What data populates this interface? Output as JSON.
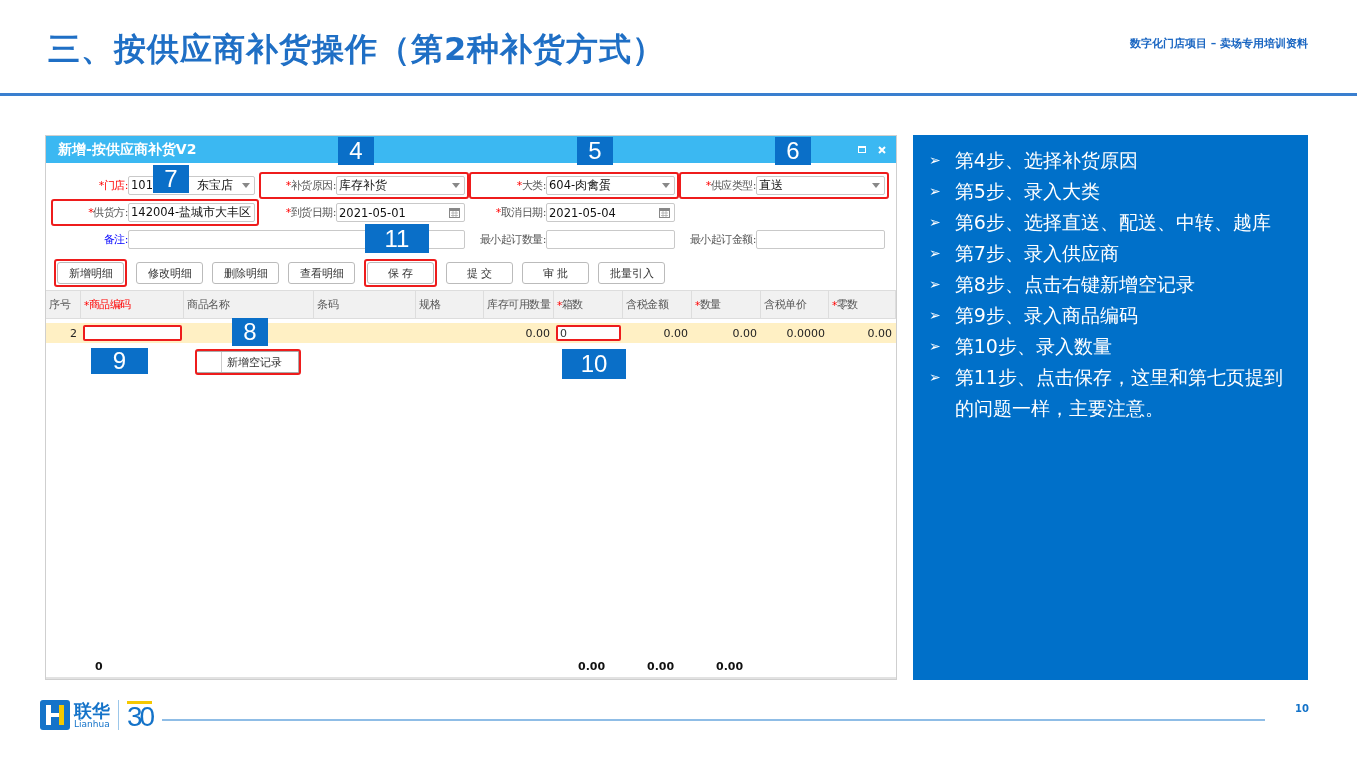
{
  "slide": {
    "title": "三、按供应商补货操作（第2种补货方式）",
    "subtitle": "数字化门店项目 – 卖场专用培训资料"
  },
  "window": {
    "title": "新增-按供应商补货V2",
    "form_rows": [
      [
        {
          "required_mark": "*",
          "label": "门店:",
          "alert": true,
          "link": false,
          "kind": "select",
          "value": "101",
          "value_tail": "东宝店",
          "highlighted": false
        },
        {
          "required_mark": "*",
          "label": "补货原因:",
          "alert": false,
          "link": false,
          "kind": "select",
          "value": "库存补货",
          "highlighted": true
        },
        {
          "required_mark": "*",
          "label": "大类:",
          "alert": false,
          "link": false,
          "kind": "select",
          "value": "604-肉禽蛋",
          "highlighted": true
        },
        {
          "required_mark": "*",
          "label": "供应类型:",
          "alert": false,
          "link": false,
          "kind": "select",
          "value": "直送",
          "highlighted": true
        }
      ],
      [
        {
          "required_mark": "*",
          "label": "供货方:",
          "alert": false,
          "link": false,
          "kind": "select",
          "value": "142004-盐城市大丰区",
          "highlighted": true
        },
        {
          "required_mark": "*",
          "label": "到货日期:",
          "alert": false,
          "link": false,
          "kind": "date",
          "value": "2021-05-01",
          "highlighted": false
        },
        {
          "required_mark": "*",
          "label": "取消日期:",
          "alert": false,
          "link": false,
          "kind": "date",
          "value": "2021-05-04",
          "highlighted": false
        }
      ],
      [
        {
          "label": "备注:",
          "alert": false,
          "link": true,
          "kind": "text",
          "wide": true,
          "highlighted": false
        },
        {
          "label": "最小起订数量:",
          "alert": false,
          "link": false,
          "kind": "text",
          "highlighted": false
        },
        {
          "label": "最小起订金额:",
          "alert": false,
          "link": false,
          "kind": "text",
          "highlighted": false
        }
      ]
    ],
    "buttons": [
      {
        "label": "新增明细",
        "highlighted": true
      },
      {
        "label": "修改明细",
        "highlighted": false
      },
      {
        "label": "删除明细",
        "highlighted": false
      },
      {
        "label": "查看明细",
        "highlighted": false
      },
      {
        "label": "保 存",
        "highlighted": true
      },
      {
        "label": "提 交",
        "highlighted": false
      },
      {
        "label": "审 批",
        "highlighted": false
      },
      {
        "label": "批量引入",
        "highlighted": false
      }
    ],
    "table": {
      "columns": [
        {
          "label": "序号",
          "alert": false
        },
        {
          "required_mark": "*",
          "label": "商品编码",
          "alert": true
        },
        {
          "label": "商品名称",
          "alert": false
        },
        {
          "label": "条码",
          "alert": false
        },
        {
          "label": "规格",
          "alert": false
        },
        {
          "label": "库存可用数量",
          "alert": false
        },
        {
          "required_mark": "*",
          "label": "箱数",
          "alert": false
        },
        {
          "label": "含税金额",
          "alert": false
        },
        {
          "required_mark": "*",
          "label": "数量",
          "alert": false
        },
        {
          "label": "含税单价",
          "alert": false
        },
        {
          "required_mark": "*",
          "label": "零数",
          "alert": false
        }
      ],
      "rows": [
        {
          "selected": true,
          "cells": [
            {
              "kind": "text",
              "text": "2"
            },
            {
              "kind": "input",
              "highlighted": true
            },
            {
              "kind": "empty"
            },
            {
              "kind": "empty"
            },
            {
              "kind": "empty"
            },
            {
              "kind": "text",
              "text": "0.00"
            },
            {
              "kind": "input",
              "value": "0",
              "highlighted": true
            },
            {
              "kind": "text",
              "text": "0.00"
            },
            {
              "kind": "text",
              "text": "0.00"
            },
            {
              "kind": "text",
              "text": "0.0000"
            },
            {
              "kind": "text",
              "text": "0.00"
            }
          ]
        }
      ],
      "totals": {
        "count": "0",
        "boxes": "0.00",
        "amount": "0.00",
        "quantity": "0.00"
      }
    },
    "context_menu": {
      "items": [
        {
          "label": "新增空记录",
          "highlighted": true
        }
      ]
    },
    "callouts": [
      "4",
      "5",
      "6",
      "7",
      "11",
      "8",
      "9",
      "10"
    ]
  },
  "steps": {
    "bullet": "➢",
    "items": [
      "第4步、选择补货原因",
      "第5步、录入大类",
      "第6步、选择直送、配送、中转、越库",
      "第7步、录入供应商",
      "第8步、点击右键新增空记录",
      "第9步、录入商品编码",
      "第10步、录入数量",
      "第11步、点击保存，这里和第七页提到的问题一样，主要注意。"
    ]
  },
  "footer": {
    "brand": "联华",
    "brand_latin": "Lianhua",
    "anniversary": "30",
    "page": "10"
  }
}
